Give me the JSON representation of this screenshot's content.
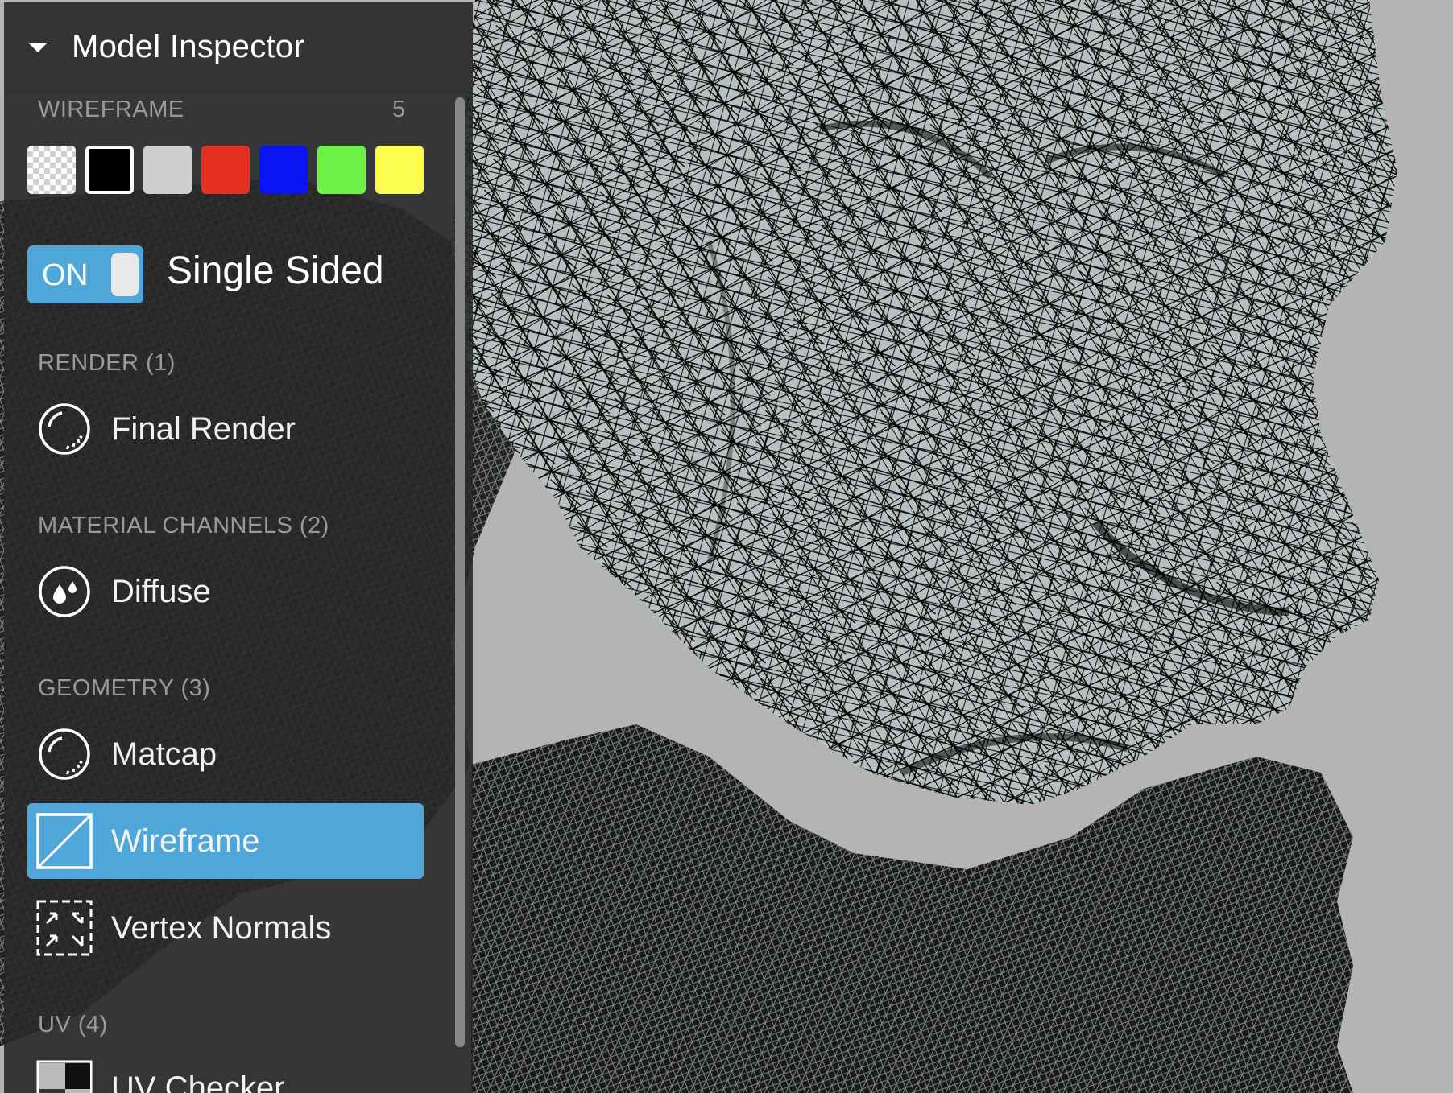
{
  "panel": {
    "title": "Model Inspector",
    "wireframe_section": {
      "label": "WIREFRAME",
      "count": "5",
      "colors": [
        {
          "name": "transparent",
          "hex": "checker",
          "selected": false
        },
        {
          "name": "black",
          "hex": "#000000",
          "selected": true
        },
        {
          "name": "light-gray",
          "hex": "#cfcfcf",
          "selected": false
        },
        {
          "name": "red",
          "hex": "#e3301f",
          "selected": false
        },
        {
          "name": "blue",
          "hex": "#0a14f0",
          "selected": false
        },
        {
          "name": "green",
          "hex": "#6cf247",
          "selected": false
        },
        {
          "name": "yellow",
          "hex": "#fcfc4f",
          "selected": false
        }
      ]
    },
    "single_sided_toggle": {
      "state_text": "ON",
      "label": "Single Sided",
      "on": true
    },
    "sections": {
      "render": {
        "label": "RENDER (1)",
        "items": [
          {
            "label": "Final Render",
            "icon": "matcap-sphere-icon"
          }
        ]
      },
      "material": {
        "label": "MATERIAL CHANNELS (2)",
        "items": [
          {
            "label": "Diffuse",
            "icon": "droplets-icon"
          }
        ]
      },
      "geometry": {
        "label": "GEOMETRY (3)",
        "items": [
          {
            "label": "Matcap",
            "icon": "matcap-sphere-icon"
          },
          {
            "label": "Wireframe",
            "icon": "wireframe-icon",
            "selected": true
          },
          {
            "label": "Vertex Normals",
            "icon": "vertex-normals-icon"
          }
        ]
      },
      "uv": {
        "label": "UV (4)",
        "items": [
          {
            "label": "UV Checker",
            "icon": "checker-icon"
          }
        ]
      }
    }
  },
  "viewport": {
    "background": "#b4b4b4",
    "mesh_fill": "#b7c0c0",
    "wire_color": "#000000"
  },
  "accent": "#4ea7d8"
}
